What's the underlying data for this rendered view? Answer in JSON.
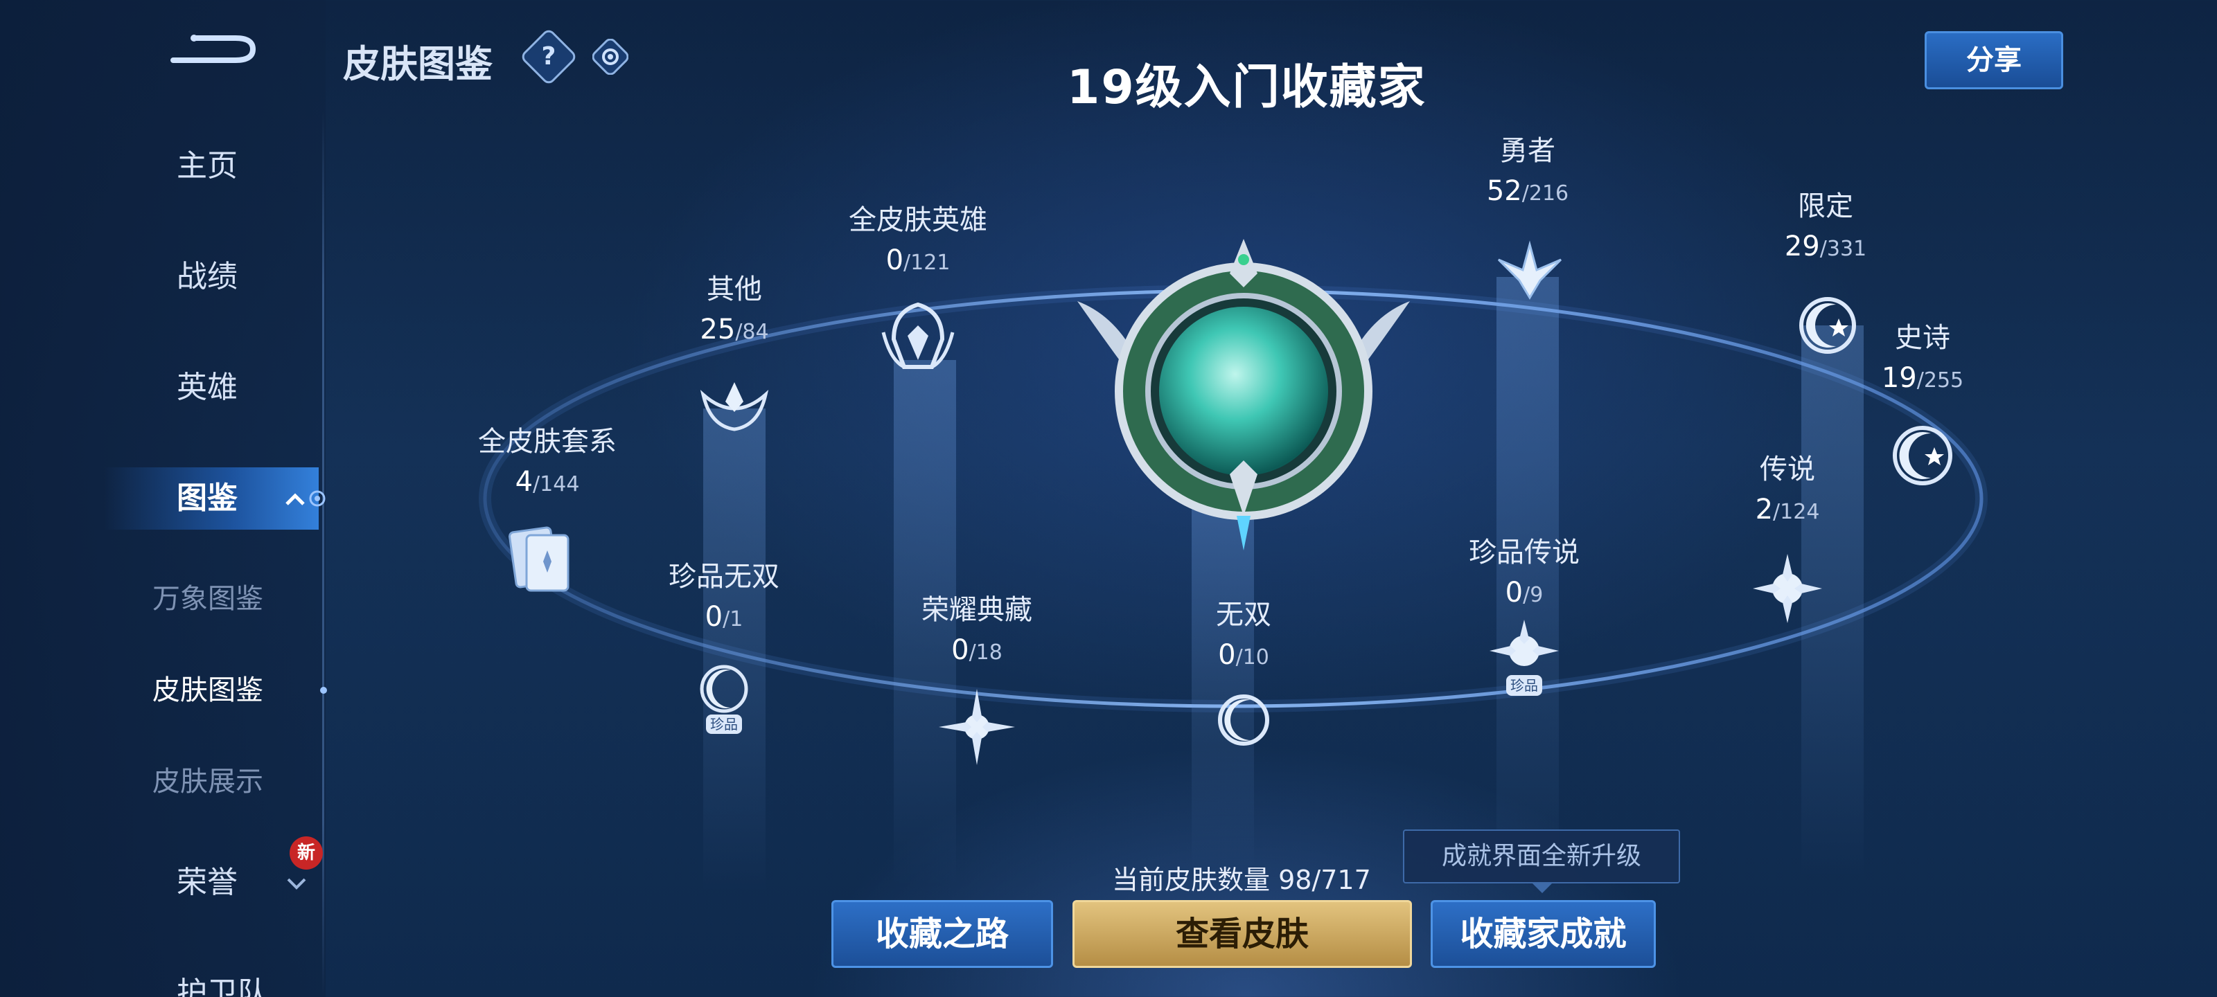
{
  "header": {
    "page_title": "皮肤图鉴",
    "main_title": "19级入门收藏家",
    "share_label": "分享",
    "help_glyph": "?"
  },
  "sidebar": {
    "items": [
      {
        "label": "主页"
      },
      {
        "label": "战绩"
      },
      {
        "label": "英雄"
      },
      {
        "label": "图鉴"
      },
      {
        "label": "万象图鉴"
      },
      {
        "label": "皮肤图鉴"
      },
      {
        "label": "皮肤展示"
      },
      {
        "label": "荣誉"
      },
      {
        "label": "护卫队"
      }
    ],
    "new_badge": "新"
  },
  "categories": [
    {
      "name": "全皮肤套系",
      "count": "4",
      "total": "/144",
      "icon": "cards-icon"
    },
    {
      "name": "其他",
      "count": "25",
      "total": "/84",
      "icon": "wing-crest-icon"
    },
    {
      "name": "全皮肤英雄",
      "count": "0",
      "total": "/121",
      "icon": "helmet-icon"
    },
    {
      "name": "勇者",
      "count": "52",
      "total": "/216",
      "icon": "star-crest-icon"
    },
    {
      "name": "限定",
      "count": "29",
      "total": "/331",
      "icon": "crescent-star-icon"
    },
    {
      "name": "史诗",
      "count": "19",
      "total": "/255",
      "icon": "crescent-star-icon"
    },
    {
      "name": "传说",
      "count": "2",
      "total": "/124",
      "icon": "sun-crest-icon"
    },
    {
      "name": "珍品传说",
      "count": "0",
      "total": "/9",
      "icon": "rare-sun-icon"
    },
    {
      "name": "无双",
      "count": "0",
      "total": "/10",
      "icon": "crescent-crest-icon"
    },
    {
      "name": "荣耀典藏",
      "count": "0",
      "total": "/18",
      "icon": "compass-star-icon"
    },
    {
      "name": "珍品无双",
      "count": "0",
      "total": "/1",
      "icon": "rare-crescent-icon"
    }
  ],
  "rare_tag": "珍品",
  "footer": {
    "skin_count_text": "当前皮肤数量 98/717",
    "tooltip": "成就界面全新升级",
    "buttons": {
      "road": "收藏之路",
      "view_skins": "查看皮肤",
      "achievements": "收藏家成就"
    }
  },
  "colors": {
    "accent_blue": "#2d6fc6",
    "accent_gold": "#e2c37e",
    "badge_red": "#c82626"
  }
}
